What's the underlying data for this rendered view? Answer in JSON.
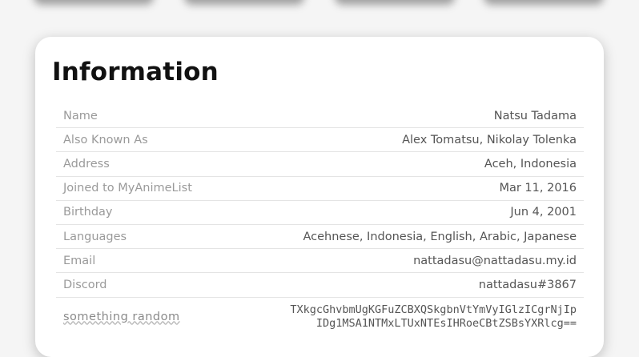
{
  "info": {
    "title": "Information",
    "rows": [
      {
        "label": "Name",
        "value": "Natsu Tadama"
      },
      {
        "label": "Also Known As",
        "value": "Alex Tomatsu, Nikolay Tolenka"
      },
      {
        "label": "Address",
        "value": "Aceh, Indonesia"
      },
      {
        "label": "Joined to MyAnimeList",
        "value": "Mar 11, 2016"
      },
      {
        "label": "Birthday",
        "value": "Jun 4, 2001"
      },
      {
        "label": "Languages",
        "value": "Acehnese, Indonesia, English,  Arabic, Japanese"
      },
      {
        "label": "Email",
        "value": "nattadasu@nattadasu.my.id"
      },
      {
        "label": "Discord",
        "value": "nattadasu#3867"
      },
      {
        "label": "something random",
        "value": "TXkgcGhvbmUgKGFuZCBXQSkgbnVtYmVyIGlzICgrNjIp\nIDg1MSA1NTMxLTUxNTEsIHRoeCBtZSBsYXRlcg=="
      }
    ]
  }
}
